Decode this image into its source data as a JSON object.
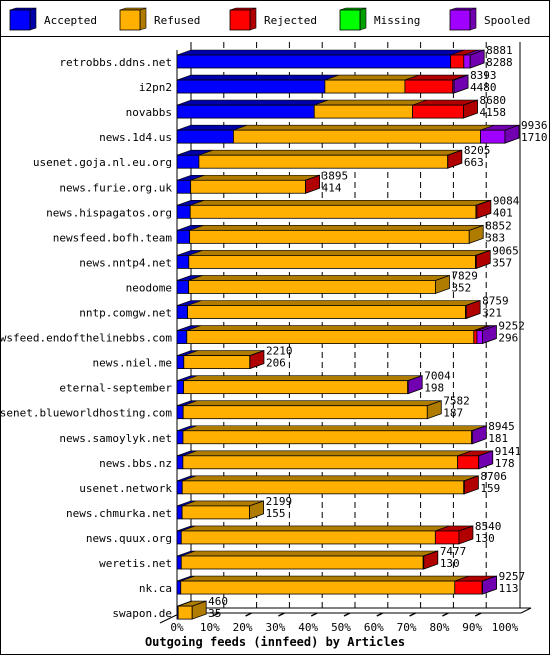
{
  "chart_data": {
    "type": "bar",
    "orientation": "horizontal",
    "stacked": true,
    "three_d": true,
    "title": "Outgoing feeds (innfeed) by Articles",
    "legend": {
      "placement": "top",
      "entries": [
        "Accepted",
        "Refused",
        "Rejected",
        "Missing",
        "Spooled"
      ]
    },
    "colors": {
      "Accepted": {
        "face": "#0000ff",
        "shade": "#0000a8"
      },
      "Refused": {
        "face": "#ffb000",
        "shade": "#b07c00"
      },
      "Rejected": {
        "face": "#ff0000",
        "shade": "#b00000"
      },
      "Missing": {
        "face": "#00ff00",
        "shade": "#00a000"
      },
      "Spooled": {
        "face": "#a000ff",
        "shade": "#7000b0"
      }
    },
    "xticks": [
      "0%",
      "10%",
      "20%",
      "30%",
      "40%",
      "50%",
      "60%",
      "70%",
      "80%",
      "90%",
      "100%"
    ],
    "grid": true,
    "categories": [
      "retrobbs.ddns.net",
      "i2pn2",
      "novabbs",
      "news.1d4.us",
      "usenet.goja.nl.eu.org",
      "news.furie.org.uk",
      "news.hispagatos.org",
      "newsfeed.bofh.team",
      "news.nntp4.net",
      "neodome",
      "nntp.comgw.net",
      "newsfeed.endofthelinebbs.com",
      "news.niel.me",
      "eternal-september",
      "usenet.blueworldhosting.com",
      "news.samoylyk.net",
      "news.bbs.nz",
      "usenet.network",
      "news.chmurka.net",
      "news.quux.org",
      "weretis.net",
      "nk.ca",
      "swapon.de"
    ],
    "totals": [
      8881,
      8393,
      8680,
      9936,
      8205,
      3895,
      9084,
      8852,
      9065,
      7829,
      8759,
      9252,
      2210,
      7004,
      7582,
      8945,
      9141,
      8706,
      2199,
      8540,
      7477,
      9257,
      460
    ],
    "series": [
      {
        "name": "Accepted",
        "values": [
          8288,
          4480,
          4158,
          1710,
          663,
          414,
          401,
          383,
          357,
          352,
          321,
          296,
          206,
          198,
          187,
          181,
          178,
          159,
          155,
          130,
          130,
          113,
          35
        ]
      },
      {
        "name": "Refused",
        "values": [
          0,
          2424,
          2977,
          7484,
          7537,
          3476,
          8653,
          8469,
          8685,
          7477,
          8418,
          8695,
          1999,
          6790,
          7395,
          8744,
          8323,
          8527,
          2044,
          7696,
          7327,
          8302,
          425
        ]
      },
      {
        "name": "Rejected",
        "values": [
          400,
          1450,
          1545,
          0,
          5,
          5,
          30,
          0,
          23,
          0,
          20,
          96,
          5,
          0,
          0,
          0,
          638,
          20,
          0,
          714,
          20,
          829,
          0
        ]
      },
      {
        "name": "Missing",
        "values": [
          0,
          0,
          0,
          0,
          0,
          0,
          0,
          0,
          0,
          0,
          0,
          0,
          0,
          0,
          0,
          0,
          0,
          0,
          0,
          0,
          0,
          0,
          0
        ]
      },
      {
        "name": "Spooled",
        "values": [
          193,
          39,
          0,
          742,
          0,
          0,
          0,
          0,
          0,
          0,
          0,
          165,
          0,
          16,
          0,
          20,
          2,
          0,
          0,
          0,
          0,
          13,
          0
        ]
      }
    ]
  }
}
